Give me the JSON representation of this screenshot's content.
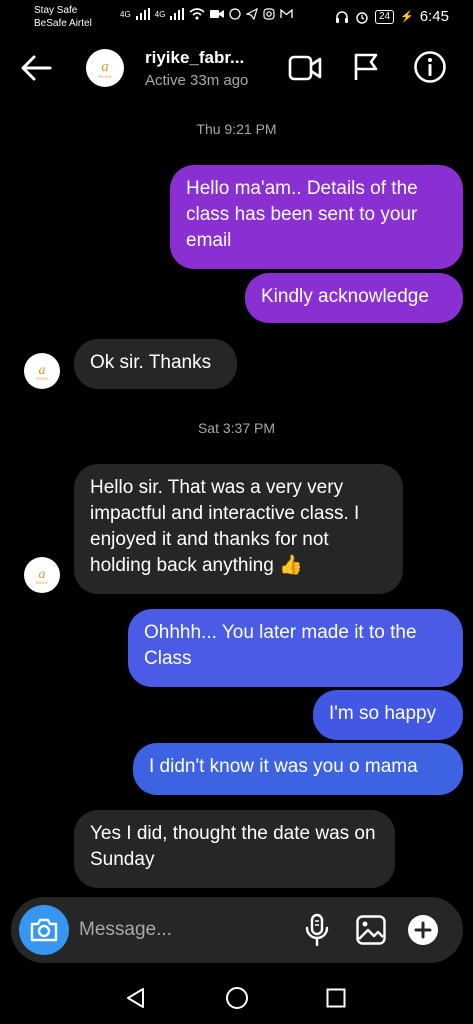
{
  "status_bar": {
    "carrier_line1": "Stay Safe",
    "carrier_line2": "BeSafe Airtel",
    "network1": "4G",
    "network2": "4G",
    "battery": "24",
    "time": "6:45"
  },
  "header": {
    "name": "riyike_fabr...",
    "status": "Active 33m ago",
    "avatar_text": "a",
    "avatar_sub": "RIYIKE"
  },
  "messages": {
    "ts1": "Thu 9:21 PM",
    "m1": "Hello ma'am.. Details of the class has been sent to your email",
    "m2": "Kindly acknowledge",
    "m3": "Ok sir. Thanks",
    "ts2": "Sat 3:37 PM",
    "m4": "Hello sir. That was a very very impactful and interactive class. I enjoyed it and thanks for not holding back anything 👍",
    "m5": "Ohhhh... You later made it to the Class",
    "m6": "I'm so happy",
    "m7": "I didn't know it was you o mama",
    "m8": "Yes I did, thought the date was on Sunday"
  },
  "composer": {
    "placeholder": "Message..."
  },
  "colors": {
    "purple": "#8a2fd1",
    "blue": "#3f5fe0",
    "incoming": "#262626",
    "camera": "#3797f0"
  }
}
